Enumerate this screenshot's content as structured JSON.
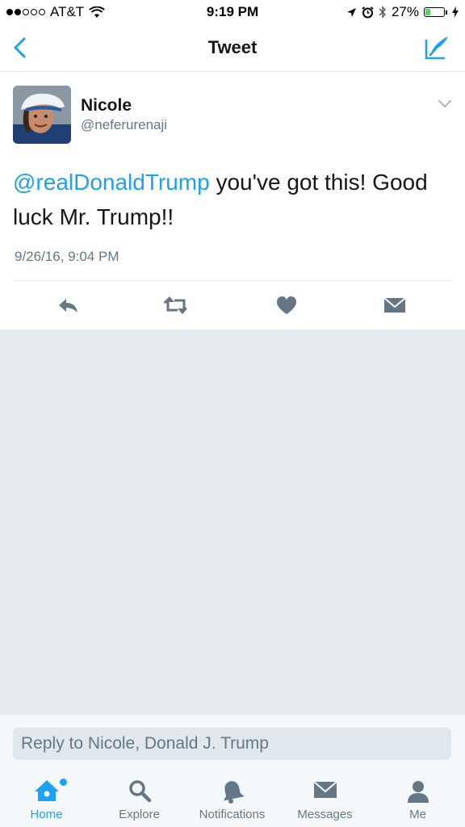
{
  "status_bar": {
    "carrier": "AT&T",
    "time": "9:19 PM",
    "battery_percent": "27%",
    "battery_level": 0.27,
    "signal_bars_filled": 2,
    "signal_bars_total": 5
  },
  "nav": {
    "title": "Tweet",
    "back_icon": "chevron-left-icon",
    "compose_icon": "compose-tweet-icon"
  },
  "tweet": {
    "author_name": "Nicole",
    "author_handle": "@neferurenaji",
    "mention": "@realDonaldTrump",
    "text_after_mention": " you've got this!  Good luck Mr. Trump!!",
    "timestamp": "9/26/16, 9:04 PM",
    "actions": [
      "reply-icon",
      "retweet-icon",
      "like-icon",
      "direct-message-icon"
    ]
  },
  "reply": {
    "placeholder": "Reply to Nicole, Donald J. Trump"
  },
  "tabs": [
    {
      "label": "Home",
      "icon": "home-icon",
      "active": true
    },
    {
      "label": "Explore",
      "icon": "search-icon",
      "active": false
    },
    {
      "label": "Notifications",
      "icon": "bell-icon",
      "active": false
    },
    {
      "label": "Messages",
      "icon": "envelope-icon",
      "active": false
    },
    {
      "label": "Me",
      "icon": "person-icon",
      "active": false
    }
  ],
  "colors": {
    "accent": "#1da1f2",
    "text": "#14171a",
    "secondary_text": "#657786",
    "icon_gray": "#657786",
    "background": "#e6ecf0"
  }
}
